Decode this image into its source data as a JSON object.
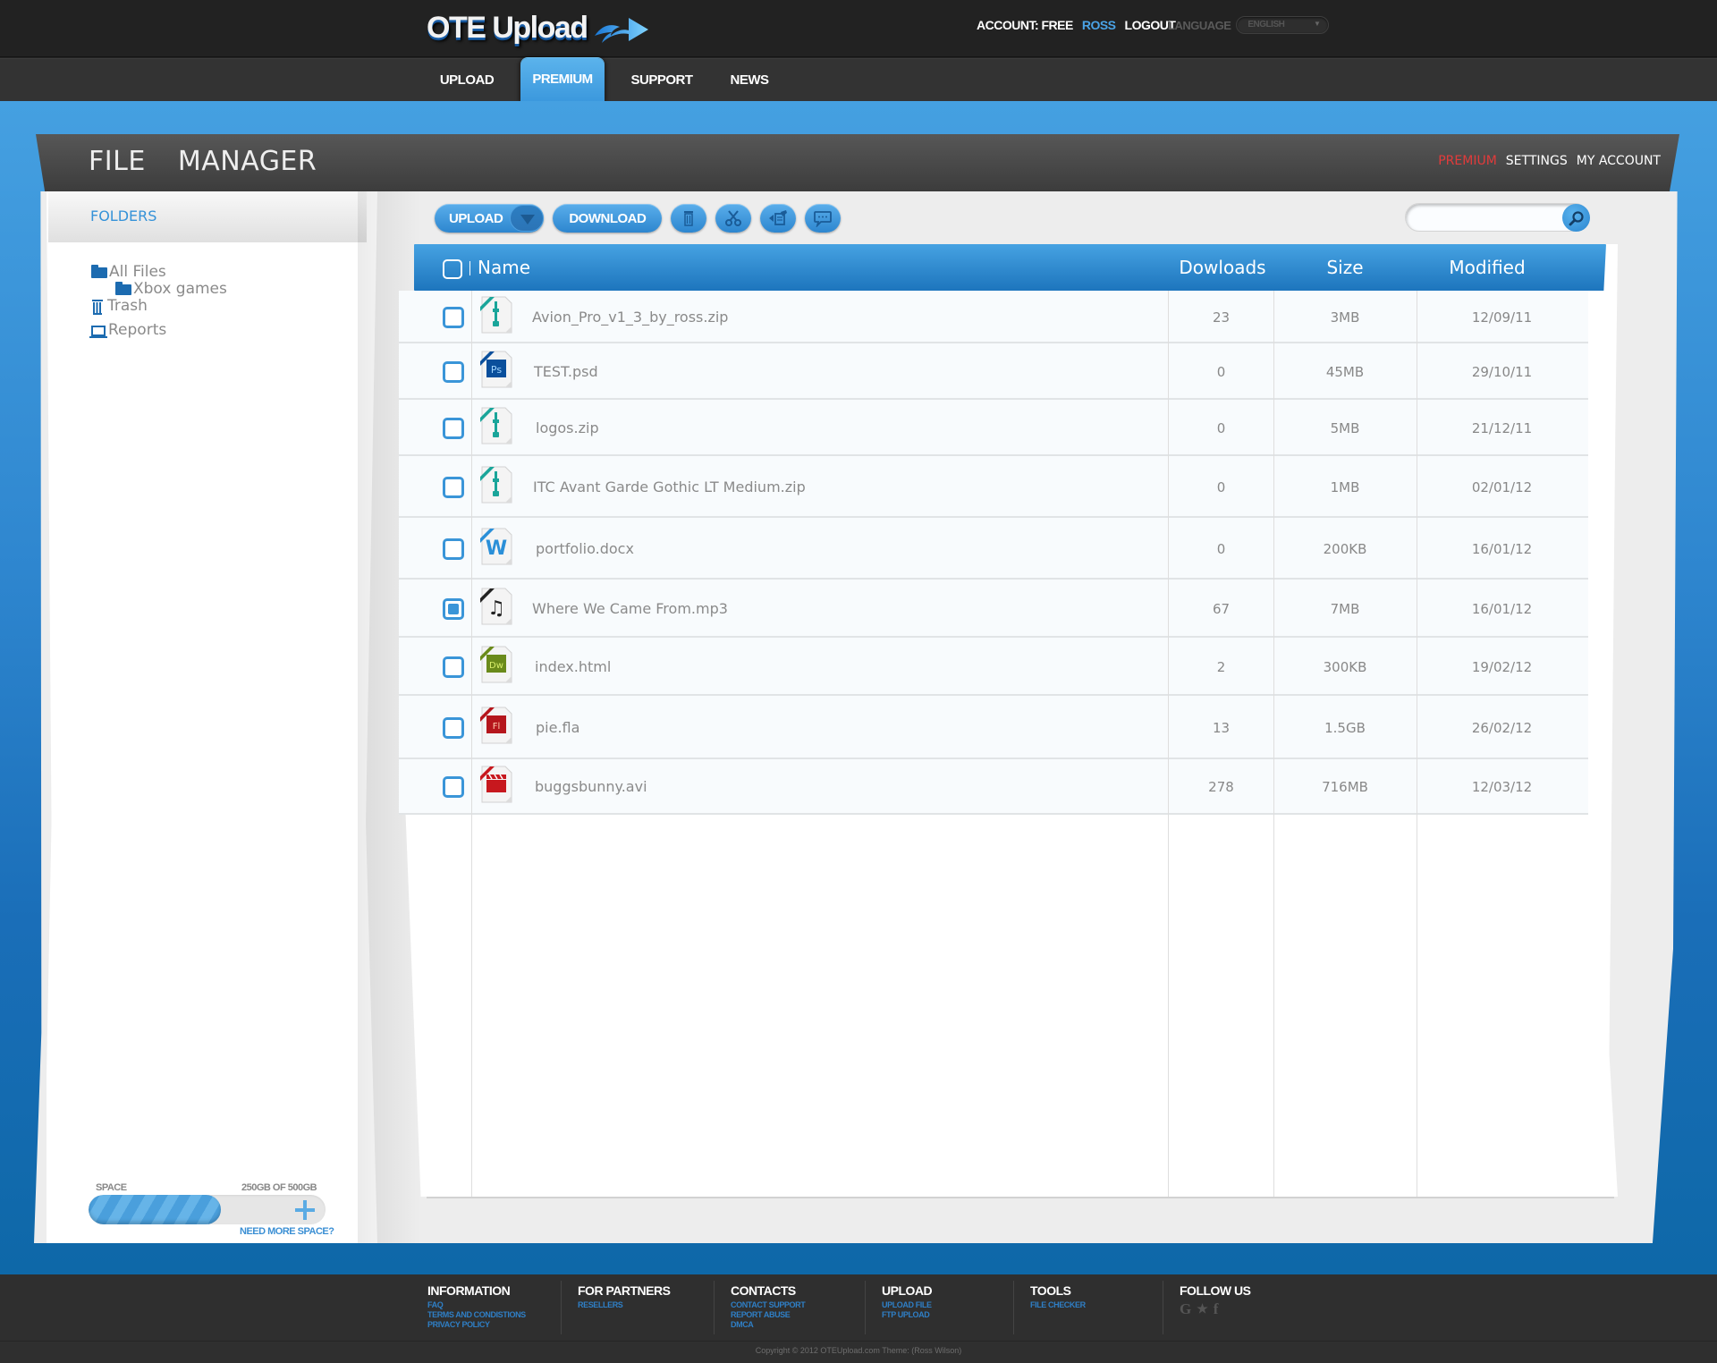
{
  "header": {
    "logo_text": "OTE Upload",
    "account_label": "ACCOUNT: FREE",
    "username": "ROSS",
    "logout_label": "LOGOUT",
    "language_label": "LANGUAGE",
    "language_value": "ENGLISH",
    "nav": [
      {
        "label": "UPLOAD",
        "active": false
      },
      {
        "label": "PREMIUM",
        "active": true
      },
      {
        "label": "SUPPORT",
        "active": false
      },
      {
        "label": "NEWS",
        "active": false
      }
    ]
  },
  "file_manager": {
    "title": "FILE  MANAGER",
    "links": {
      "premium": "PREMIUM",
      "settings": "SETTINGS",
      "account": "MY ACCOUNT"
    },
    "sidebar": {
      "heading": "FOLDERS",
      "tree": [
        {
          "label": "All Files",
          "icon": "folder-icon"
        },
        {
          "label": "Xbox games",
          "icon": "folder-icon"
        },
        {
          "label": "Trash",
          "icon": "trash-icon"
        },
        {
          "label": "Reports",
          "icon": "laptop-icon"
        }
      ],
      "space": {
        "label": "SPACE",
        "value_text": "250GB OF 500GB",
        "used_fraction": 0.5,
        "more_link": "NEED MORE SPACE?"
      }
    },
    "toolbar": {
      "upload_label": "UPLOAD",
      "download_label": "DOWNLOAD",
      "icon_buttons": [
        "trash-icon",
        "scissors-icon",
        "move-icon",
        "comment-icon"
      ],
      "search_placeholder": ""
    },
    "table": {
      "columns": {
        "name": "Name",
        "downloads": "Dowloads",
        "size": "Size",
        "modified": "Modified"
      },
      "rows": [
        {
          "name": "Avion_Pro_v1_3_by_ross.zip",
          "type": "zip",
          "downloads": "23",
          "size": "3MB",
          "modified": "12/09/11",
          "checked": false
        },
        {
          "name": "TEST.psd",
          "type": "psd",
          "downloads": "0",
          "size": "45MB",
          "modified": "29/10/11",
          "checked": false
        },
        {
          "name": "logos.zip",
          "type": "zip",
          "downloads": "0",
          "size": "5MB",
          "modified": "21/12/11",
          "checked": false
        },
        {
          "name": "ITC Avant Garde Gothic LT Medium.zip",
          "type": "zip",
          "downloads": "0",
          "size": "1MB",
          "modified": "02/01/12",
          "checked": false
        },
        {
          "name": "portfolio.docx",
          "type": "docx",
          "downloads": "0",
          "size": "200KB",
          "modified": "16/01/12",
          "checked": false
        },
        {
          "name": "Where We Came From.mp3",
          "type": "mp3",
          "downloads": "67",
          "size": "7MB",
          "modified": "16/01/12",
          "checked": true
        },
        {
          "name": "index.html",
          "type": "html",
          "downloads": "2",
          "size": "300KB",
          "modified": "19/02/12",
          "checked": false
        },
        {
          "name": "pie.fla",
          "type": "fla",
          "downloads": "13",
          "size": "1.5GB",
          "modified": "26/02/12",
          "checked": false
        },
        {
          "name": "buggsbunny.avi",
          "type": "avi",
          "downloads": "278",
          "size": "716MB",
          "modified": "12/03/12",
          "checked": false
        }
      ]
    }
  },
  "footer": {
    "columns": [
      {
        "title": "INFORMATION",
        "links": [
          "FAQ",
          "TERMS AND CONDISTIONS",
          "PRIVACY POLICY"
        ]
      },
      {
        "title": "FOR PARTNERS",
        "links": [
          "RESELLERS"
        ]
      },
      {
        "title": "CONTACTS",
        "links": [
          "CONTACT SUPPORT",
          "REPORT ABUSE",
          "DMCA"
        ]
      },
      {
        "title": "UPLOAD",
        "links": [
          "UPLOAD FILE",
          "FTP UPLOAD"
        ]
      },
      {
        "title": "TOOLS",
        "links": [
          "FILE CHECKER"
        ]
      },
      {
        "title": "FOLLOW US",
        "links": []
      }
    ],
    "social": [
      "google-icon",
      "twitter-icon",
      "facebook-icon"
    ],
    "copyright": "Copyright © 2012 OTEUpload.com Theme: (Ross Wilson)"
  },
  "colors": {
    "accent": "#3592d8",
    "premium_red": "#e23b3b",
    "dark_bar": "#222222",
    "file_type_badges": {
      "zip": "#1aa59a",
      "psd": "#0a4f9c",
      "docx": "#2a8fd8",
      "mp3": "#222222",
      "html": "#6a8a1a",
      "fla": "#b5151b",
      "avi": "#c7181e"
    }
  }
}
